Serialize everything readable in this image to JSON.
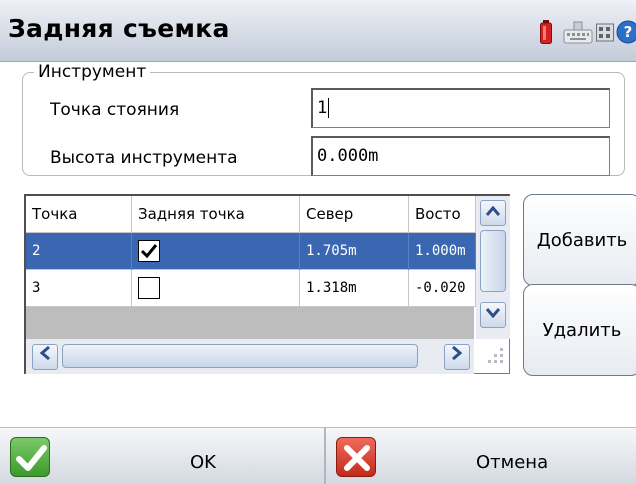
{
  "window": {
    "title": "Задняя съемка",
    "status_icons": [
      "battery-icon",
      "keyboard-icon",
      "grid-icon",
      "help-icon"
    ]
  },
  "instrument": {
    "legend": "Инструмент",
    "station_label": "Точка стояния",
    "station_value": "1",
    "height_label": "Высота инструмента",
    "height_value": "0.000m"
  },
  "table": {
    "columns": [
      "Точка",
      "Задняя точка",
      "Север",
      "Восто"
    ],
    "rows": [
      {
        "point": "2",
        "backsight": true,
        "north": "1.705m",
        "east": "1.000m",
        "selected": true
      },
      {
        "point": "3",
        "backsight": false,
        "north": "1.318m",
        "east": "-0.020",
        "selected": false
      }
    ]
  },
  "buttons": {
    "add": "Добавить",
    "delete": "Удалить",
    "ok": "OK",
    "cancel": "Отмена"
  },
  "colors": {
    "selection": "#3a66b2",
    "ok_icon": "#3d9a2b",
    "cancel_icon": "#d23a2b"
  }
}
